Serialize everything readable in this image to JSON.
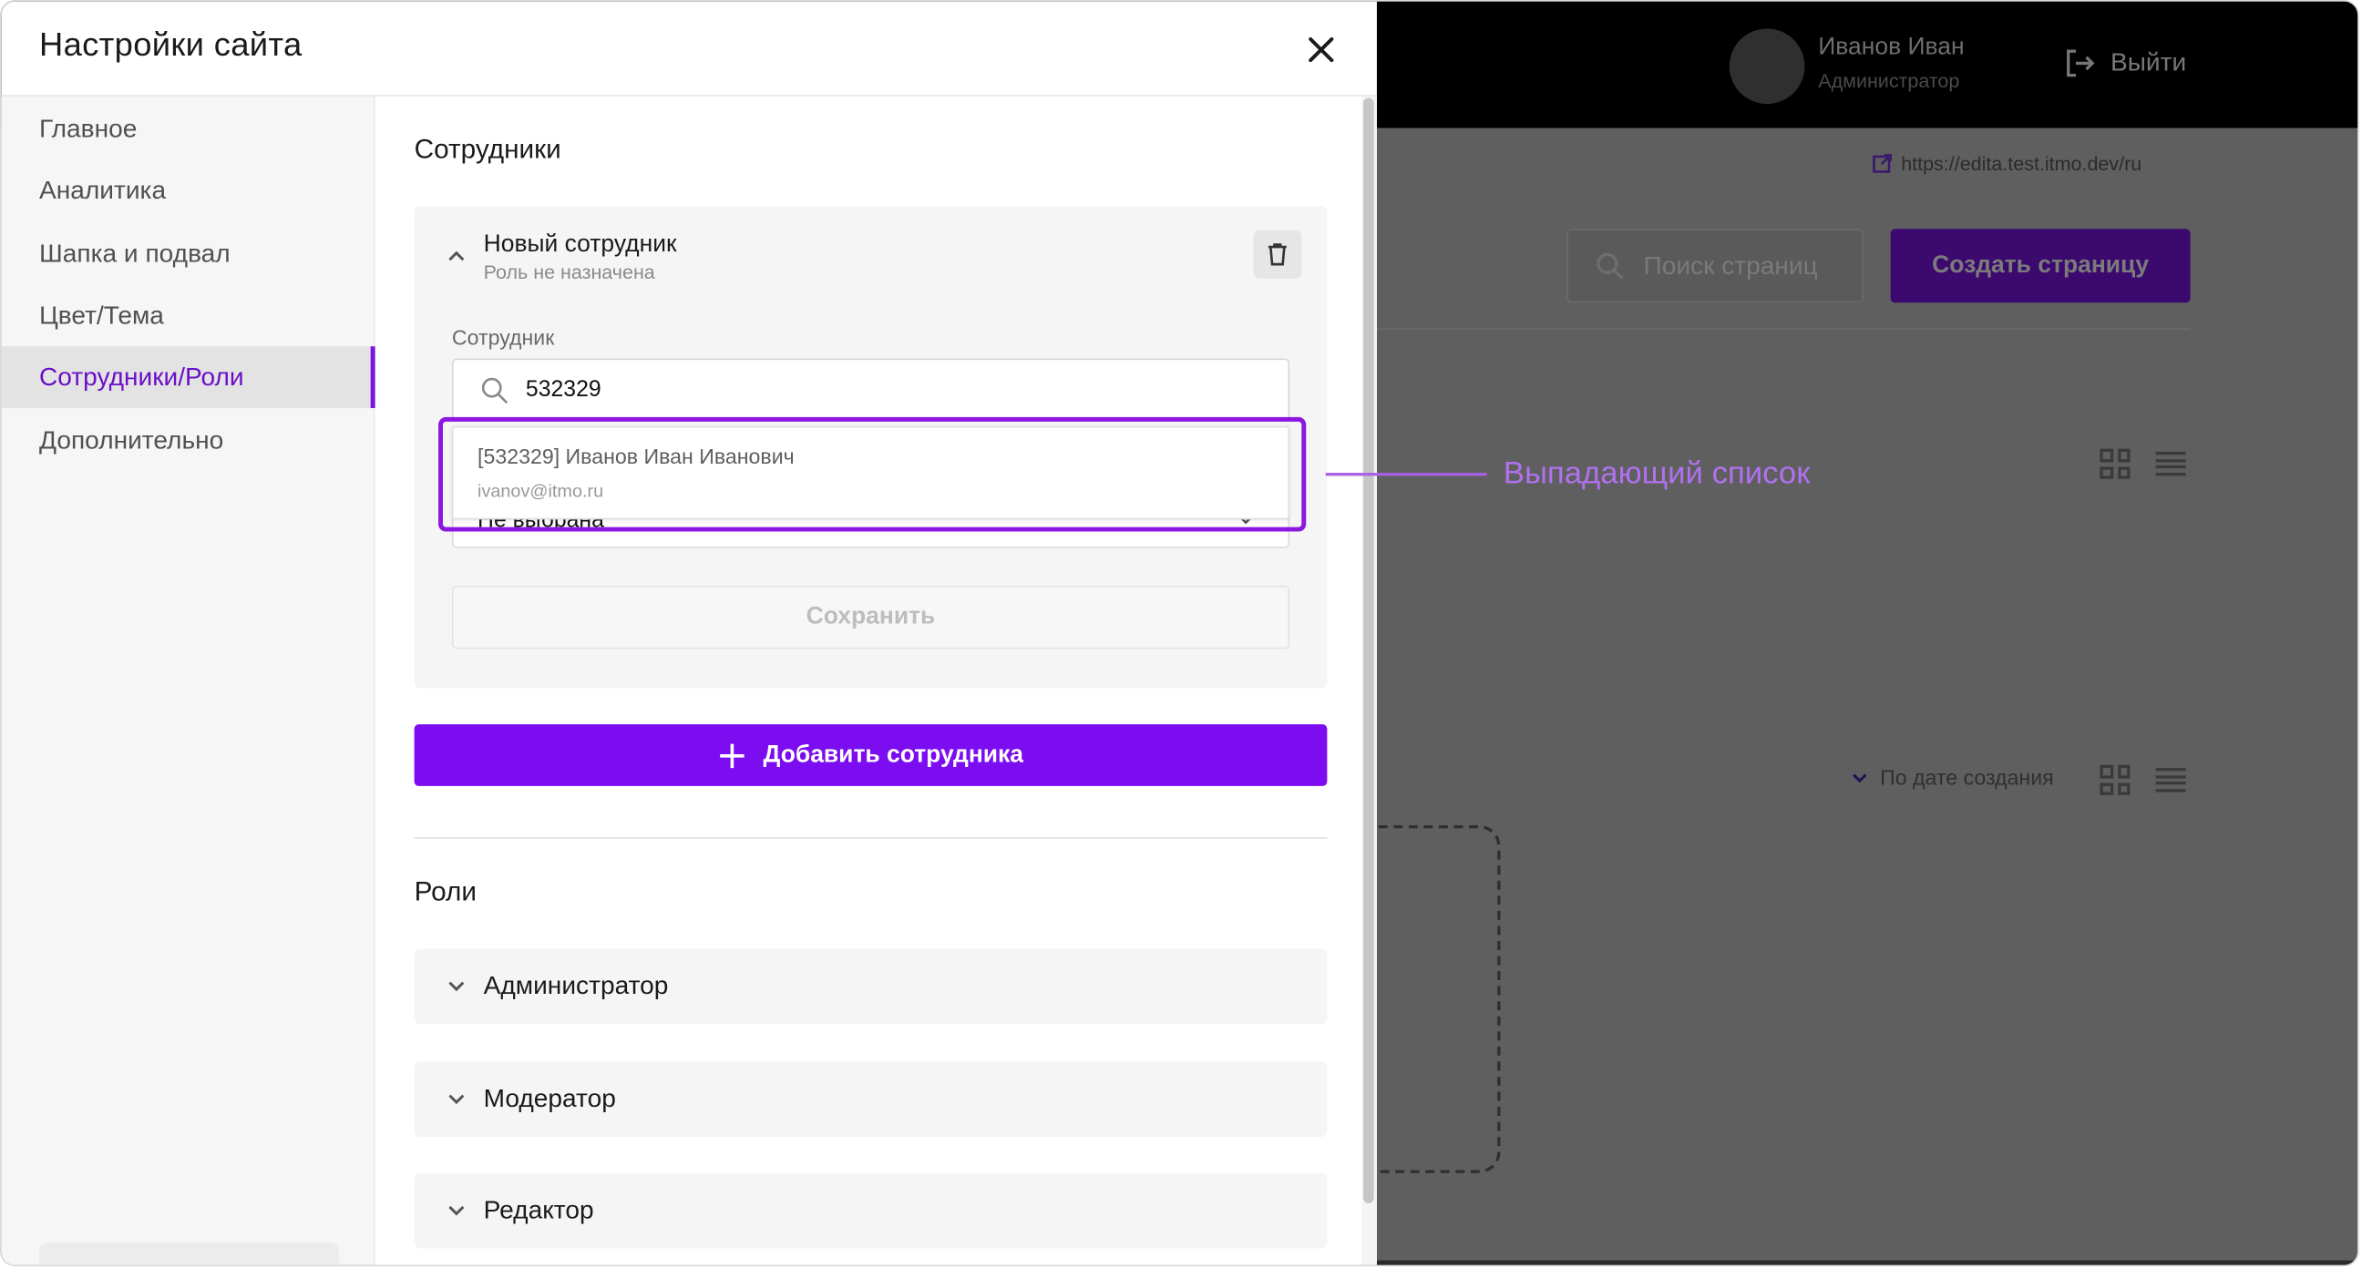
{
  "modal": {
    "title": "Настройки сайта"
  },
  "sidebar": {
    "items": [
      {
        "label": "Главное"
      },
      {
        "label": "Аналитика"
      },
      {
        "label": "Шапка и подвал"
      },
      {
        "label": "Цвет/Тема"
      },
      {
        "label": "Сотрудники/Роли",
        "active": true
      },
      {
        "label": "Дополнительно"
      }
    ]
  },
  "employees": {
    "section_title": "Сотрудники",
    "card": {
      "name": "Новый сотрудник",
      "subtitle": "Роль не назначена",
      "field_label": "Сотрудник",
      "search_value": "532329",
      "role_value": "Не выбрана",
      "save_label": "Сохранить"
    },
    "dropdown": {
      "option_name": "[532329] Иванов Иван Иванович",
      "option_email": "ivanov@itmo.ru"
    },
    "callout": "Выпадающий список",
    "add_label": "Добавить сотрудника"
  },
  "roles": {
    "section_title": "Роли",
    "items": [
      {
        "label": "Администратор"
      },
      {
        "label": "Модератор"
      },
      {
        "label": "Редактор"
      }
    ]
  },
  "background": {
    "user_name": "Иванов Иван",
    "user_role": "Администратор",
    "logout_label": "Выйти",
    "site_link": "https://edita.test.itmo.dev/ru",
    "search_placeholder": "Поиск страниц",
    "create_label": "Создать страницу",
    "sort_label": "По дате создания"
  },
  "colors": {
    "accent": "#7b0df0",
    "highlight": "#8b17e0",
    "callout": "#b171ee",
    "active_nav": "#6a10c9"
  }
}
